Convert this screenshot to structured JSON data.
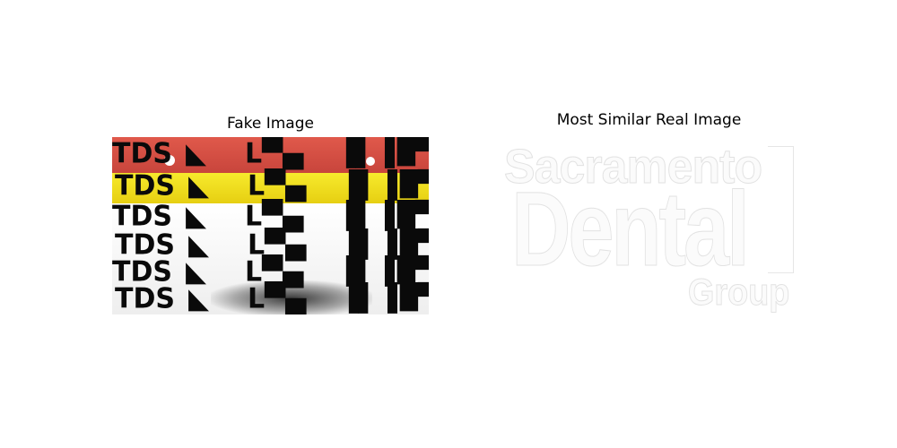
{
  "left_panel": {
    "title": "Fake Image"
  },
  "right_panel": {
    "title": "Most Similar Real Image",
    "logo_lines": [
      "Sacramento",
      "Dental",
      "Group"
    ]
  },
  "colors": {
    "red_band": "#d94a3f",
    "yellow_band": "#f4e21e",
    "text_dark": "#0a0a0a"
  }
}
